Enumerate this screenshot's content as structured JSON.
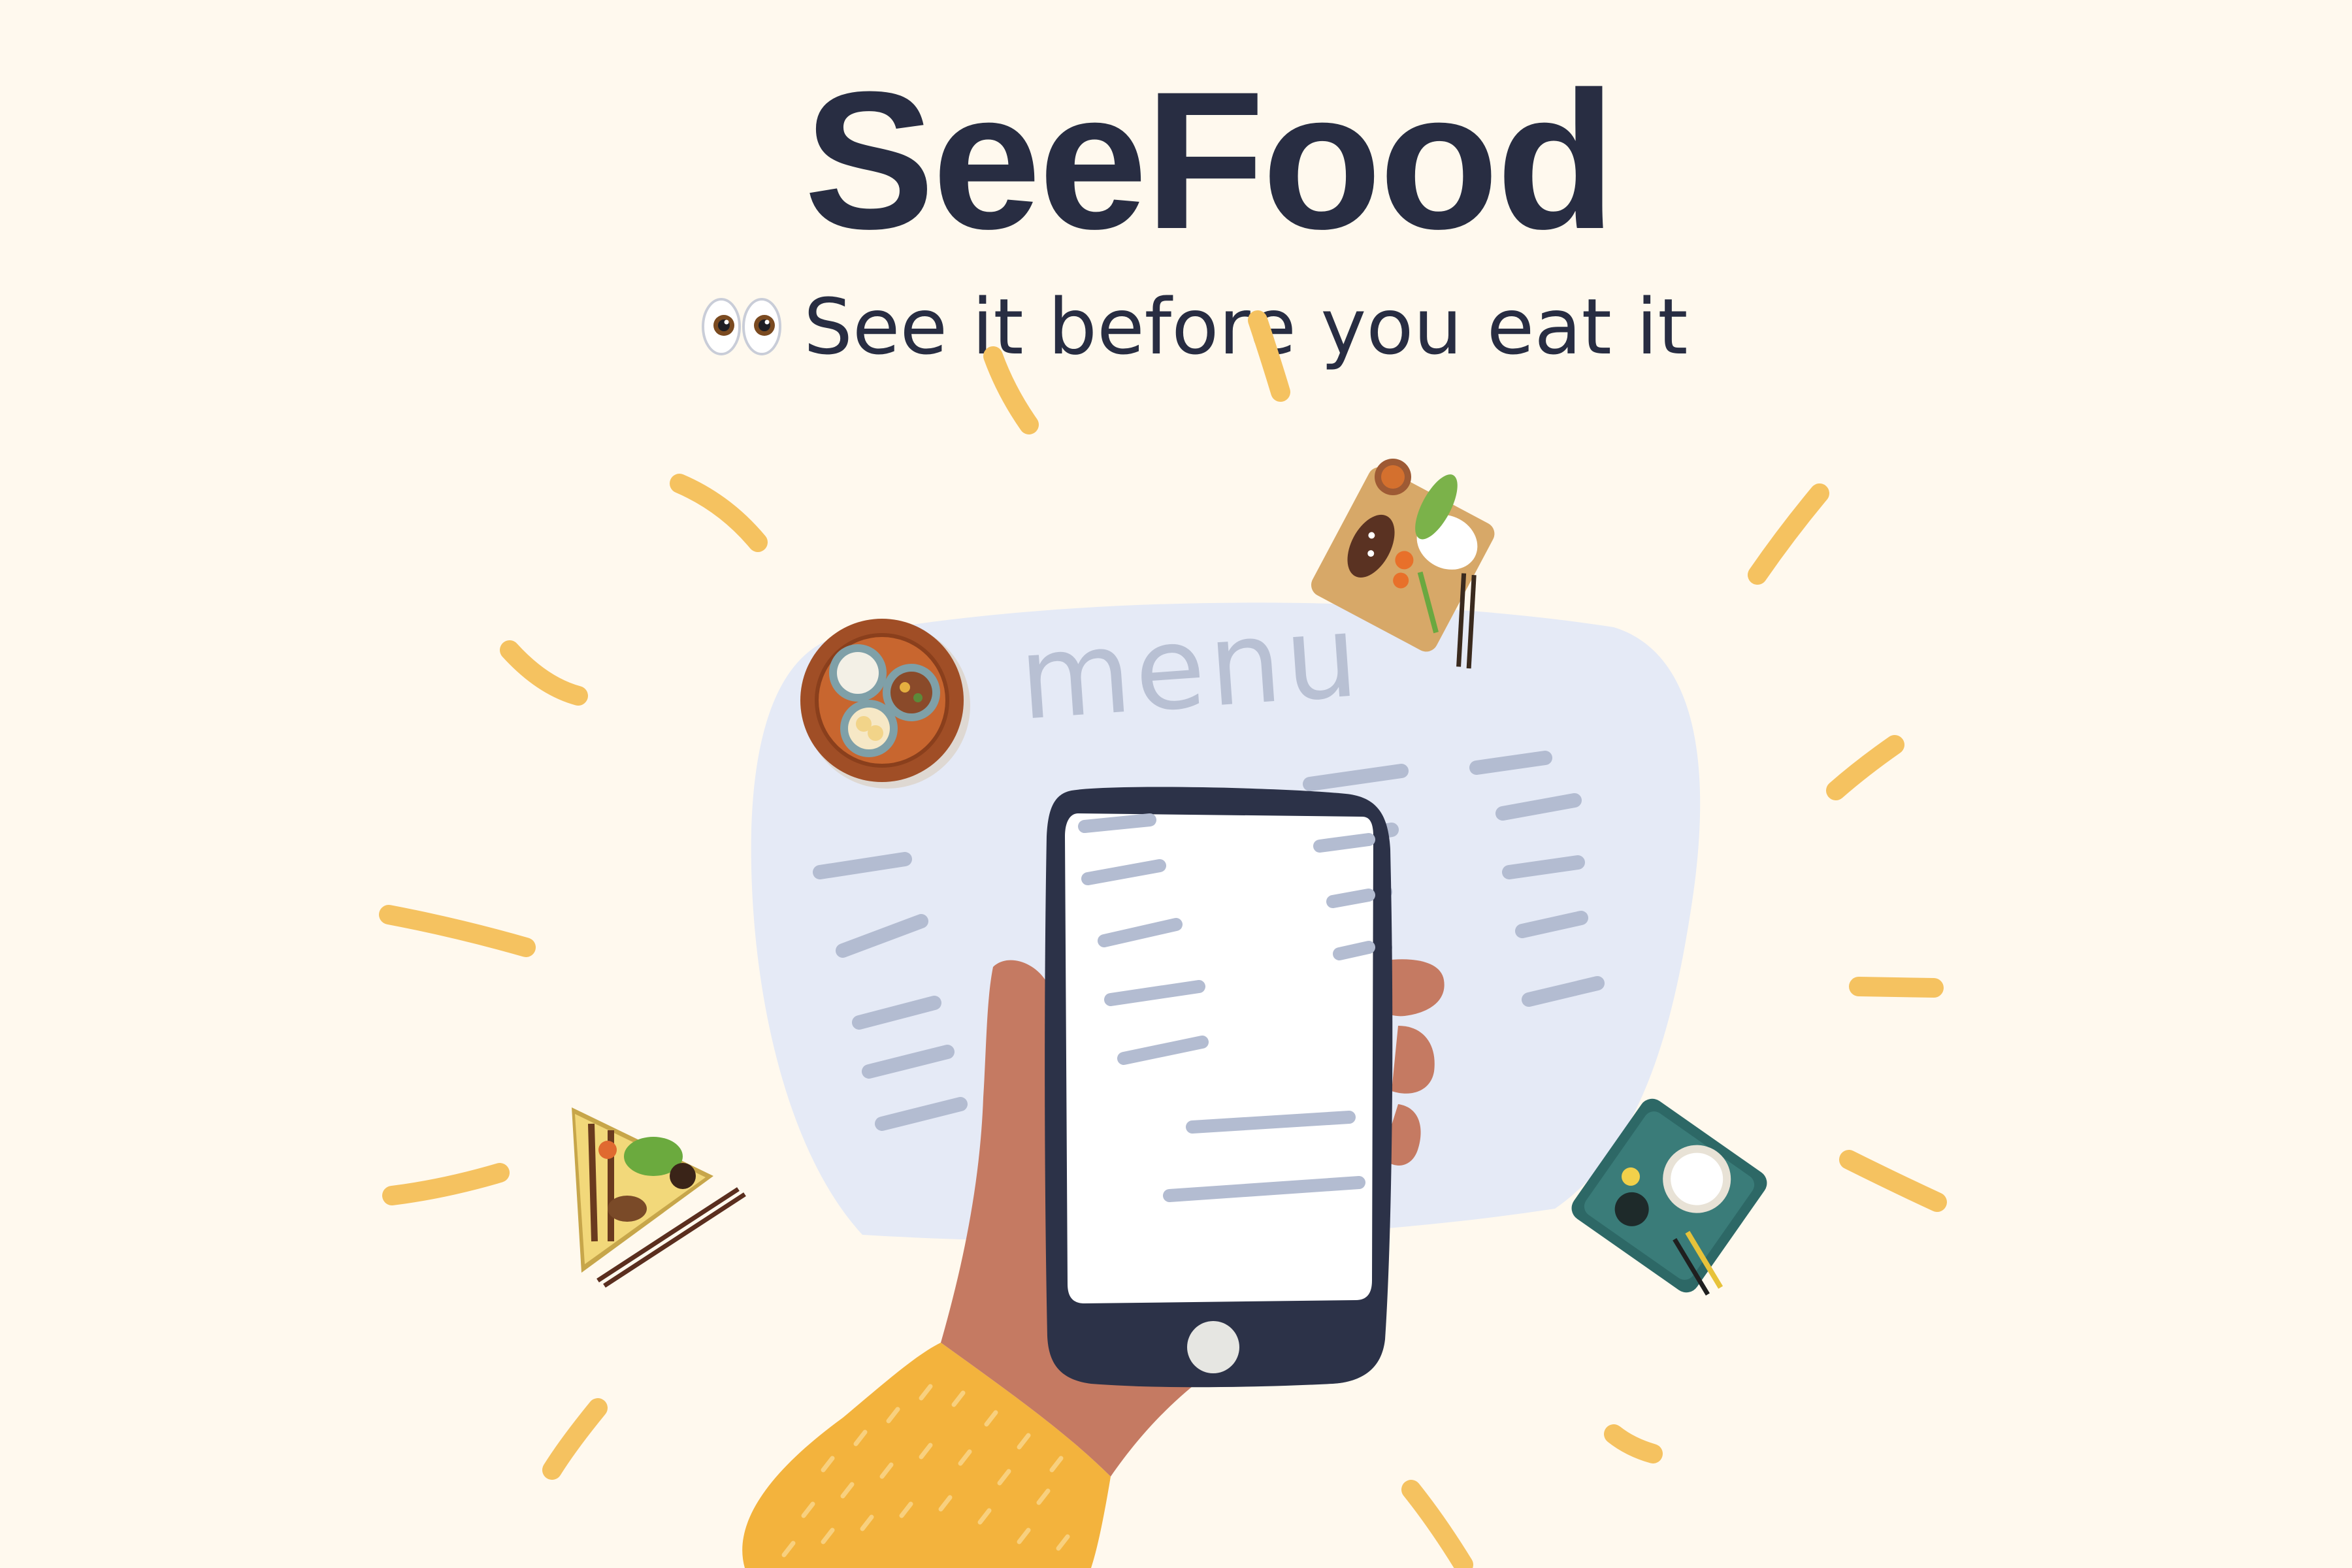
{
  "app": {
    "title": "SeeFood",
    "tagline": "See it before you eat it"
  },
  "illustration": {
    "menu_card_label": "menu",
    "icons": [
      "eyes-icon",
      "hand-icon",
      "smartphone-icon",
      "steamer-basket-icon",
      "bento-board-icon",
      "kebab-plate-icon",
      "rice-tray-icon"
    ]
  },
  "colors": {
    "background": "#FFF9EE",
    "text": "#282D42",
    "menu_card": "#E5EAF6",
    "menu_lines": "#B3BCD1",
    "phone_frame": "#2C3248",
    "skin": "#C57A62",
    "sleeve": "#F3B33D",
    "rays": "#F5C260"
  }
}
